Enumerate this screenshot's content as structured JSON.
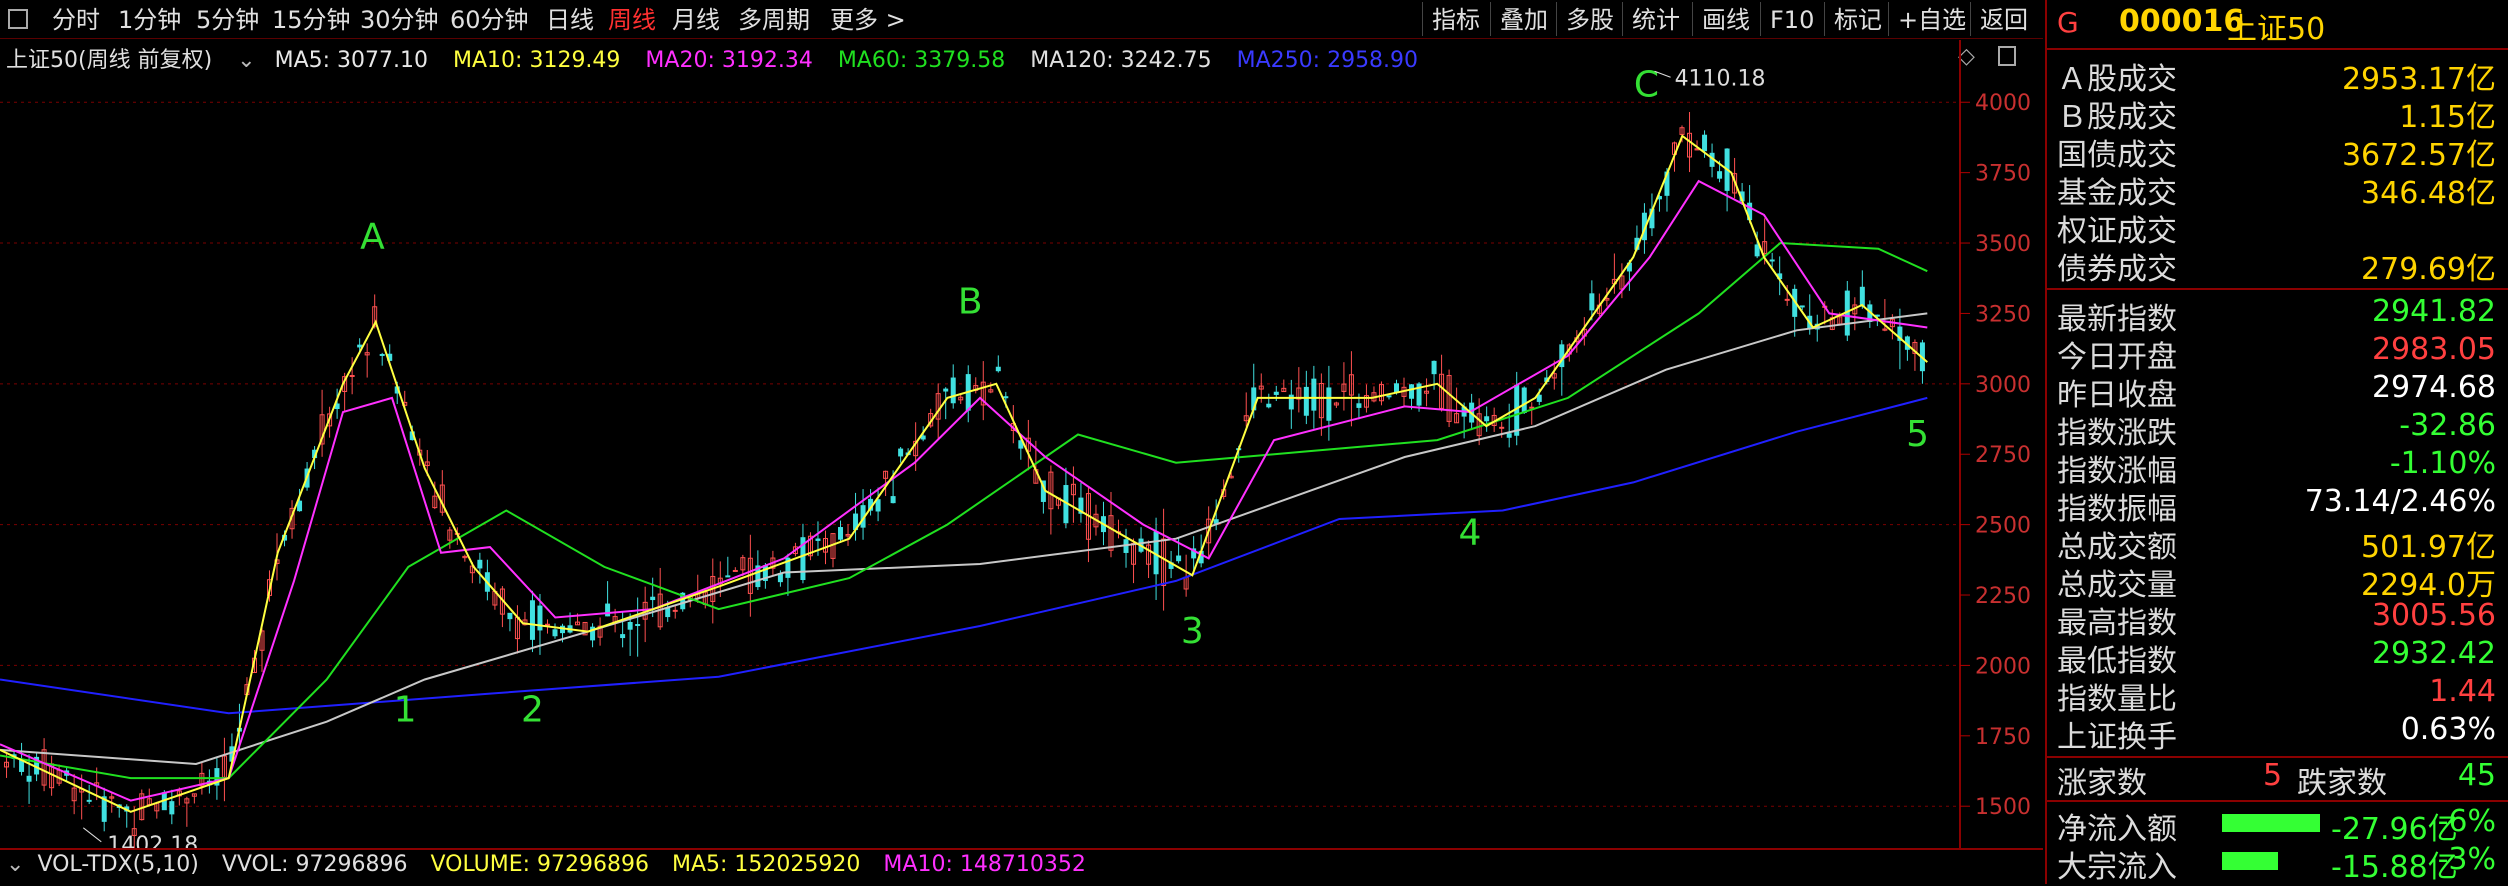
{
  "toolbar": {
    "left_tabs": [
      "分时",
      "1分钟",
      "5分钟",
      "15分钟",
      "30分钟",
      "60分钟",
      "日线",
      "周线",
      "月线",
      "多周期",
      "更多 >"
    ],
    "active_tab": "周线",
    "right_tabs": [
      "指标",
      "叠加",
      "多股",
      "统计",
      "画线",
      "F10",
      "标记",
      "+自选",
      "返回"
    ]
  },
  "ma_bar": {
    "title": "上证50(周线 前复权)",
    "ma5": "MA5: 3077.10",
    "ma10": "MA10: 3129.49",
    "ma20": "MA20: 3192.34",
    "ma60": "MA60: 3379.58",
    "ma120": "MA120: 3242.75",
    "ma250": "MA250: 2958.90"
  },
  "vol_bar": {
    "name": "VOL-TDX(5,10)",
    "vvol": "VVOL: 97296896",
    "volume": "VOLUME: 97296896",
    "ma5": "MA5: 152025920",
    "ma10": "MA10: 148710352"
  },
  "chart_data": {
    "type": "line",
    "y_ticks": [
      1500,
      1750,
      2000,
      2250,
      2500,
      2750,
      3000,
      3250,
      3500,
      3750,
      4000
    ],
    "ylim": [
      1380,
      4150
    ],
    "high_label": "4110.18",
    "low_label": "1402.18",
    "wave_labels": [
      {
        "text": "A",
        "x": 0.114,
        "y": 3480
      },
      {
        "text": "B",
        "x": 0.297,
        "y": 3250
      },
      {
        "text": "C",
        "x": 0.504,
        "y": 4020
      },
      {
        "text": "1",
        "x": 0.124,
        "y": 1800
      },
      {
        "text": "2",
        "x": 0.163,
        "y": 1800
      },
      {
        "text": "3",
        "x": 0.365,
        "y": 2080
      },
      {
        "text": "4",
        "x": 0.45,
        "y": 2430
      },
      {
        "text": "5",
        "x": 0.587,
        "y": 2780
      }
    ],
    "series": [
      {
        "name": "MA250",
        "color": "#2020ff",
        "points": [
          [
            0.0,
            1950
          ],
          [
            0.07,
            1830
          ],
          [
            0.15,
            1900
          ],
          [
            0.22,
            1960
          ],
          [
            0.3,
            2140
          ],
          [
            0.36,
            2300
          ],
          [
            0.41,
            2520
          ],
          [
            0.46,
            2550
          ],
          [
            0.5,
            2650
          ],
          [
            0.55,
            2830
          ],
          [
            0.59,
            2950
          ]
        ]
      },
      {
        "name": "MA120",
        "color": "#c8c8c8",
        "points": [
          [
            0.0,
            1700
          ],
          [
            0.06,
            1650
          ],
          [
            0.1,
            1800
          ],
          [
            0.13,
            1950
          ],
          [
            0.18,
            2120
          ],
          [
            0.24,
            2330
          ],
          [
            0.3,
            2360
          ],
          [
            0.36,
            2450
          ],
          [
            0.43,
            2740
          ],
          [
            0.47,
            2850
          ],
          [
            0.51,
            3050
          ],
          [
            0.55,
            3190
          ],
          [
            0.59,
            3250
          ]
        ]
      },
      {
        "name": "MA60",
        "color": "#20e020",
        "points": [
          [
            0.0,
            1680
          ],
          [
            0.04,
            1600
          ],
          [
            0.07,
            1600
          ],
          [
            0.1,
            1950
          ],
          [
            0.125,
            2350
          ],
          [
            0.155,
            2550
          ],
          [
            0.185,
            2350
          ],
          [
            0.22,
            2200
          ],
          [
            0.26,
            2310
          ],
          [
            0.29,
            2500
          ],
          [
            0.33,
            2820
          ],
          [
            0.36,
            2720
          ],
          [
            0.4,
            2760
          ],
          [
            0.44,
            2800
          ],
          [
            0.48,
            2950
          ],
          [
            0.52,
            3250
          ],
          [
            0.545,
            3500
          ],
          [
            0.575,
            3480
          ],
          [
            0.59,
            3400
          ]
        ]
      },
      {
        "name": "MA20",
        "color": "#ff30ff",
        "points": [
          [
            0.0,
            1720
          ],
          [
            0.04,
            1520
          ],
          [
            0.07,
            1600
          ],
          [
            0.09,
            2300
          ],
          [
            0.105,
            2900
          ],
          [
            0.12,
            2950
          ],
          [
            0.135,
            2400
          ],
          [
            0.15,
            2420
          ],
          [
            0.17,
            2170
          ],
          [
            0.2,
            2200
          ],
          [
            0.24,
            2380
          ],
          [
            0.28,
            2720
          ],
          [
            0.3,
            2950
          ],
          [
            0.32,
            2740
          ],
          [
            0.35,
            2500
          ],
          [
            0.37,
            2380
          ],
          [
            0.39,
            2800
          ],
          [
            0.43,
            2920
          ],
          [
            0.45,
            2900
          ],
          [
            0.48,
            3100
          ],
          [
            0.505,
            3450
          ],
          [
            0.52,
            3720
          ],
          [
            0.54,
            3600
          ],
          [
            0.56,
            3250
          ],
          [
            0.59,
            3200
          ]
        ]
      },
      {
        "name": "MA5",
        "color": "#ffff40",
        "points": [
          [
            0.0,
            1700
          ],
          [
            0.04,
            1480
          ],
          [
            0.07,
            1600
          ],
          [
            0.085,
            2400
          ],
          [
            0.105,
            3000
          ],
          [
            0.115,
            3220
          ],
          [
            0.13,
            2700
          ],
          [
            0.145,
            2350
          ],
          [
            0.16,
            2150
          ],
          [
            0.18,
            2120
          ],
          [
            0.22,
            2280
          ],
          [
            0.26,
            2450
          ],
          [
            0.29,
            2950
          ],
          [
            0.305,
            3000
          ],
          [
            0.32,
            2620
          ],
          [
            0.35,
            2420
          ],
          [
            0.365,
            2320
          ],
          [
            0.385,
            2950
          ],
          [
            0.42,
            2950
          ],
          [
            0.44,
            3000
          ],
          [
            0.455,
            2850
          ],
          [
            0.47,
            2950
          ],
          [
            0.5,
            3450
          ],
          [
            0.515,
            3880
          ],
          [
            0.53,
            3750
          ],
          [
            0.54,
            3450
          ],
          [
            0.555,
            3200
          ],
          [
            0.57,
            3280
          ],
          [
            0.59,
            3077
          ]
        ]
      }
    ]
  },
  "right_panel": {
    "code": "000016",
    "name": "上证50",
    "g": "G",
    "rows1": [
      {
        "label": "Ａ股成交",
        "value": "2953.17亿",
        "color": "#ffd400"
      },
      {
        "label": "Ｂ股成交",
        "value": "1.15亿",
        "color": "#ffd400"
      },
      {
        "label": "国债成交",
        "value": "3672.57亿",
        "color": "#ffd400"
      },
      {
        "label": "基金成交",
        "value": "346.48亿",
        "color": "#ffd400"
      },
      {
        "label": "权证成交",
        "value": "",
        "color": "#ffd400"
      },
      {
        "label": "债券成交",
        "value": "279.69亿",
        "color": "#ffd400"
      }
    ],
    "rows2": [
      {
        "label": "最新指数",
        "value": "2941.82",
        "color": "#34ff34"
      },
      {
        "label": "今日开盘",
        "value": "2983.05",
        "color": "#ff4040"
      },
      {
        "label": "昨日收盘",
        "value": "2974.68",
        "color": "#ffffff"
      },
      {
        "label": "指数涨跌",
        "value": "-32.86",
        "color": "#34ff34"
      },
      {
        "label": "指数涨幅",
        "value": "-1.10%",
        "color": "#34ff34"
      },
      {
        "label": "指数振幅",
        "value": "73.14/2.46%",
        "color": "#ffffff"
      },
      {
        "label": "总成交额",
        "value": "501.97亿",
        "color": "#ffd400"
      },
      {
        "label": "总成交量",
        "value": "2294.0万",
        "color": "#ffd400"
      },
      {
        "label": "最高指数",
        "value": "3005.56",
        "color": "#ff4040"
      },
      {
        "label": "最低指数",
        "value": "2932.42",
        "color": "#34ff34"
      },
      {
        "label": "指数量比",
        "value": "1.44",
        "color": "#ff4040"
      },
      {
        "label": "上证换手",
        "value": "0.63%",
        "color": "#ffffff"
      }
    ],
    "updown": {
      "up_label": "涨家数",
      "up_value": "5",
      "down_label": "跌家数",
      "down_value": "45"
    },
    "flows": [
      {
        "label": "净流入额",
        "amount": "-27.96亿",
        "pct": "-6%",
        "bar": 0.7
      },
      {
        "label": "大宗流入",
        "amount": "-15.88亿",
        "pct": "-3%",
        "bar": 0.4
      }
    ]
  }
}
